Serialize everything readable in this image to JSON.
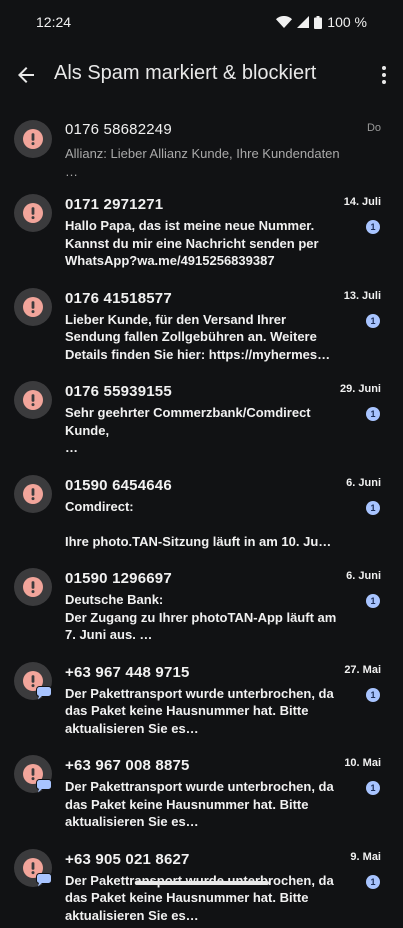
{
  "status": {
    "time": "12:24",
    "battery": "100 %"
  },
  "appbar": {
    "title": "Als Spam markiert & blockiert"
  },
  "conversations": [
    {
      "name": "0176 58682249",
      "snippet": "Allianz: Lieber Allianz Kunde, Ihre Kundendaten …",
      "date": "Do",
      "unread": "",
      "chat": false
    },
    {
      "name": "0171 2971271",
      "snippet": "Hallo Papa, das ist meine neue Nummer. Kannst du mir eine Nachricht senden per WhatsApp?wa.me/4915256839387",
      "date": "14. Juli",
      "unread": "1",
      "chat": false
    },
    {
      "name": "0176 41518577",
      "snippet": "Lieber Kunde, für den Versand Ihrer Sendung fallen Zollgebühren an. Weitere Details finden Sie hier: https://myhermes…",
      "date": "13. Juli",
      "unread": "1",
      "chat": false
    },
    {
      "name": "0176 55939155",
      "snippet": "Sehr geehrter Commerzbank/Comdirect Kunde,\n…",
      "date": "29. Juni",
      "unread": "1",
      "chat": false
    },
    {
      "name": "01590 6454646",
      "snippet": "Comdirect:\n\nIhre photo.TAN-Sitzung läuft in am 10. Ju…",
      "date": "6. Juni",
      "unread": "1",
      "chat": false
    },
    {
      "name": "01590 1296697",
      "snippet": "Deutsche Bank:\nDer Zugang zu Ihrer photoTAN-App läuft am 7. Juni aus. …",
      "date": "6. Juni",
      "unread": "1",
      "chat": false
    },
    {
      "name": "+63 967 448 9715",
      "snippet": "Der Pakettransport wurde unterbrochen, da das Paket keine Hausnummer hat. Bitte aktualisieren Sie es…",
      "date": "27. Mai",
      "unread": "1",
      "chat": true
    },
    {
      "name": "+63 967 008 8875",
      "snippet": "Der Pakettransport wurde unterbrochen, da das Paket keine Hausnummer hat. Bitte aktualisieren Sie es…",
      "date": "10. Mai",
      "unread": "1",
      "chat": true
    },
    {
      "name": "+63 905 021 8627",
      "snippet": "Der Pakettransport wurde unterbrochen, da das Paket keine Hausnummer hat. Bitte aktualisieren Sie es…",
      "date": "9. Mai",
      "unread": "1",
      "chat": true
    }
  ],
  "icons": {
    "avatar": "spam-alert-icon",
    "back": "arrow-back-icon",
    "more": "more-vert-icon"
  },
  "colors": {
    "background": "#111214",
    "avatar_bg": "#3b3b3d",
    "alert": "#f2a59b",
    "badge": "#a8c4ff"
  }
}
